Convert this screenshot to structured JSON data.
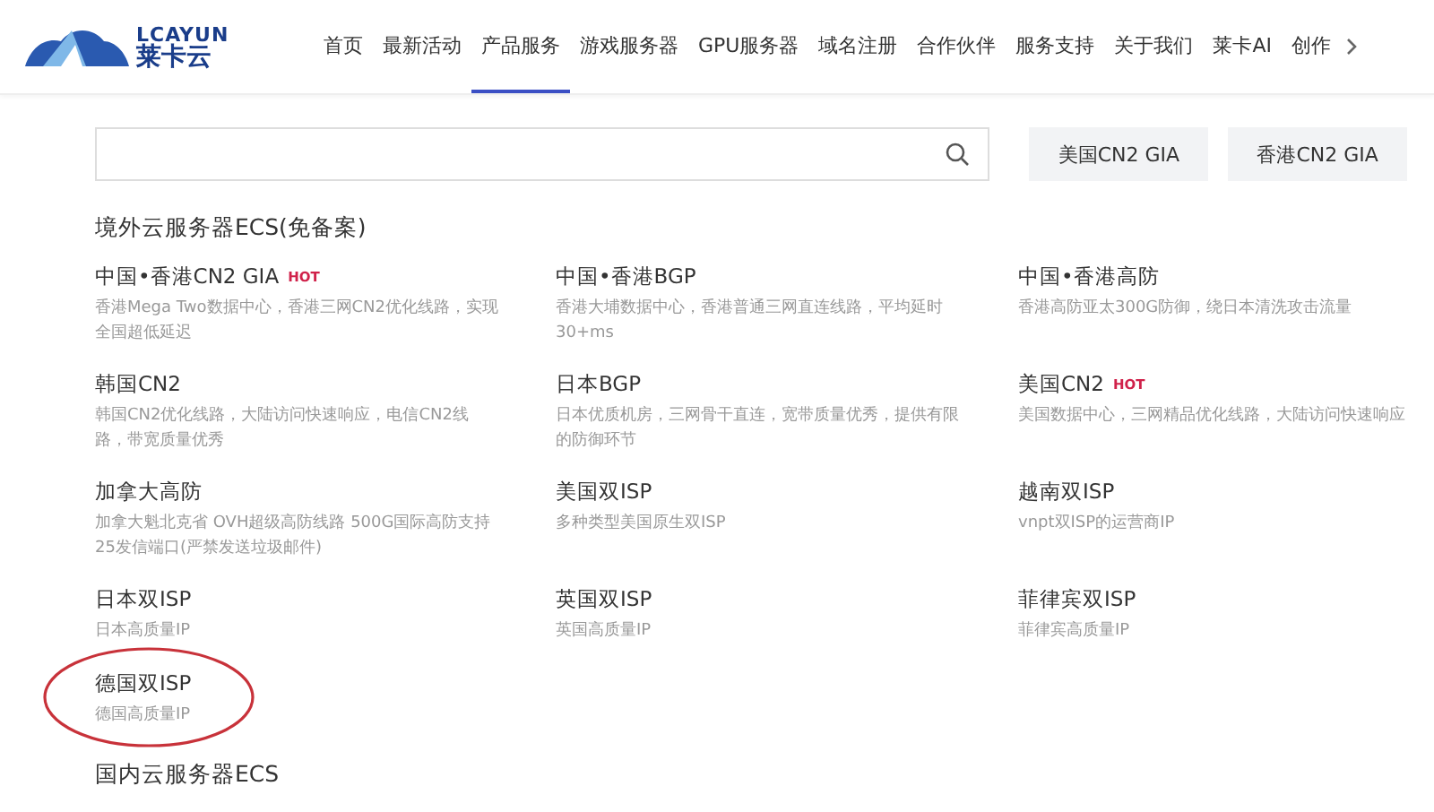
{
  "logo": {
    "latin": "LCAYUN",
    "chinese": "莱卡云"
  },
  "nav": [
    {
      "label": "首页",
      "selected": false
    },
    {
      "label": "最新活动",
      "selected": false
    },
    {
      "label": "产品服务",
      "selected": true
    },
    {
      "label": "游戏服务器",
      "selected": false
    },
    {
      "label": "GPU服务器",
      "selected": false
    },
    {
      "label": "域名注册",
      "selected": false
    },
    {
      "label": "合作伙伴",
      "selected": false
    },
    {
      "label": "服务支持",
      "selected": false
    },
    {
      "label": "关于我们",
      "selected": false
    },
    {
      "label": "莱卡AI",
      "selected": false
    },
    {
      "label": "创作",
      "selected": false
    }
  ],
  "search": {
    "buttons": [
      "美国CN2 GIA",
      "香港CN2 GIA"
    ]
  },
  "sections": [
    {
      "title": "境外云服务器ECS(免备案)",
      "products": [
        {
          "name": "中国•香港CN2 GIA",
          "badge": "HOT",
          "description": "香港Mega Two数据中心，香港三网CN2优化线路，实现全国超低延迟",
          "circled": false
        },
        {
          "name": "中国•香港BGP",
          "description": "香港大埔数据中心，香港普通三网直连线路，平均延时30+ms",
          "circled": false
        },
        {
          "name": "中国•香港高防",
          "description": "香港高防亚太300G防御，绕日本清洗攻击流量",
          "circled": false
        },
        {
          "name": "韩国CN2",
          "description": "韩国CN2优化线路，大陆访问快速响应，电信CN2线路，带宽质量优秀",
          "circled": false
        },
        {
          "name": "日本BGP",
          "description": "日本优质机房，三网骨干直连，宽带质量优秀，提供有限的防御环节",
          "circled": false
        },
        {
          "name": "美国CN2",
          "badge": "HOT",
          "description": "美国数据中心，三网精品优化线路，大陆访问快速响应",
          "circled": false
        },
        {
          "name": "加拿大高防",
          "description": "加拿大魁北克省 OVH超级高防线路 500G国际高防支持25发信端口(严禁发送垃圾邮件)",
          "circled": false
        },
        {
          "name": "美国双ISP",
          "description": "多种类型美国原生双ISP",
          "circled": false
        },
        {
          "name": "越南双ISP",
          "description": "vnpt双ISP的运营商IP",
          "circled": false
        },
        {
          "name": "日本双ISP",
          "description": "日本高质量IP",
          "circled": false
        },
        {
          "name": "英国双ISP",
          "description": "英国高质量IP",
          "circled": false
        },
        {
          "name": "菲律宾双ISP",
          "description": "菲律宾高质量IP",
          "circled": false
        },
        {
          "name": "德国双ISP",
          "description": "德国高质量IP",
          "circled": true
        }
      ]
    },
    {
      "title": "国内云服务器ECS"
    }
  ]
}
